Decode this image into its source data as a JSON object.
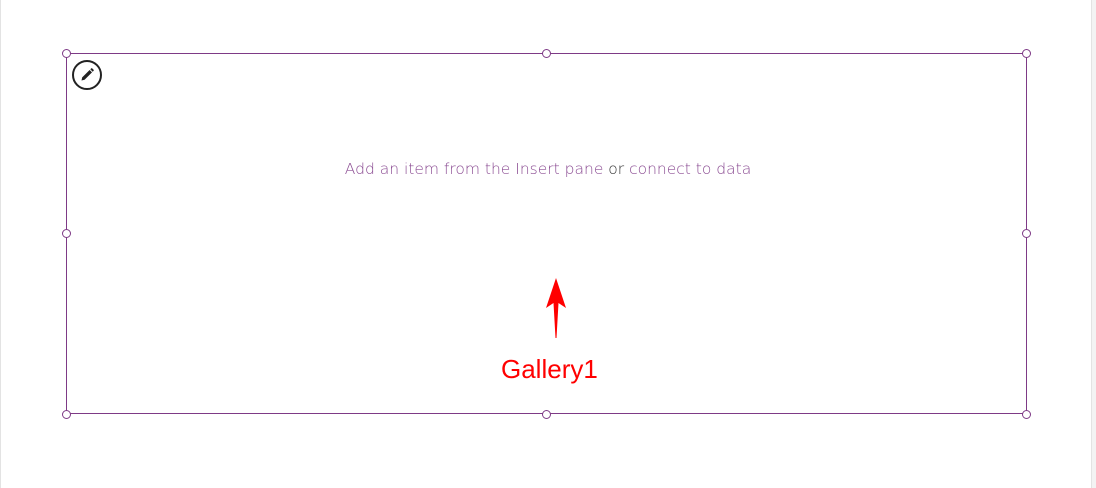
{
  "gallery": {
    "name": "Gallery1",
    "placeholder": {
      "part1": "Add an item from the Insert pane",
      "or": "or",
      "link": "connect to data"
    },
    "edit_icon": "pencil-icon",
    "border_color": "#7e3a86"
  },
  "annotation": {
    "label": "Gallery1",
    "color": "#ff0000",
    "arrow_icon": "arrow-up-icon"
  }
}
